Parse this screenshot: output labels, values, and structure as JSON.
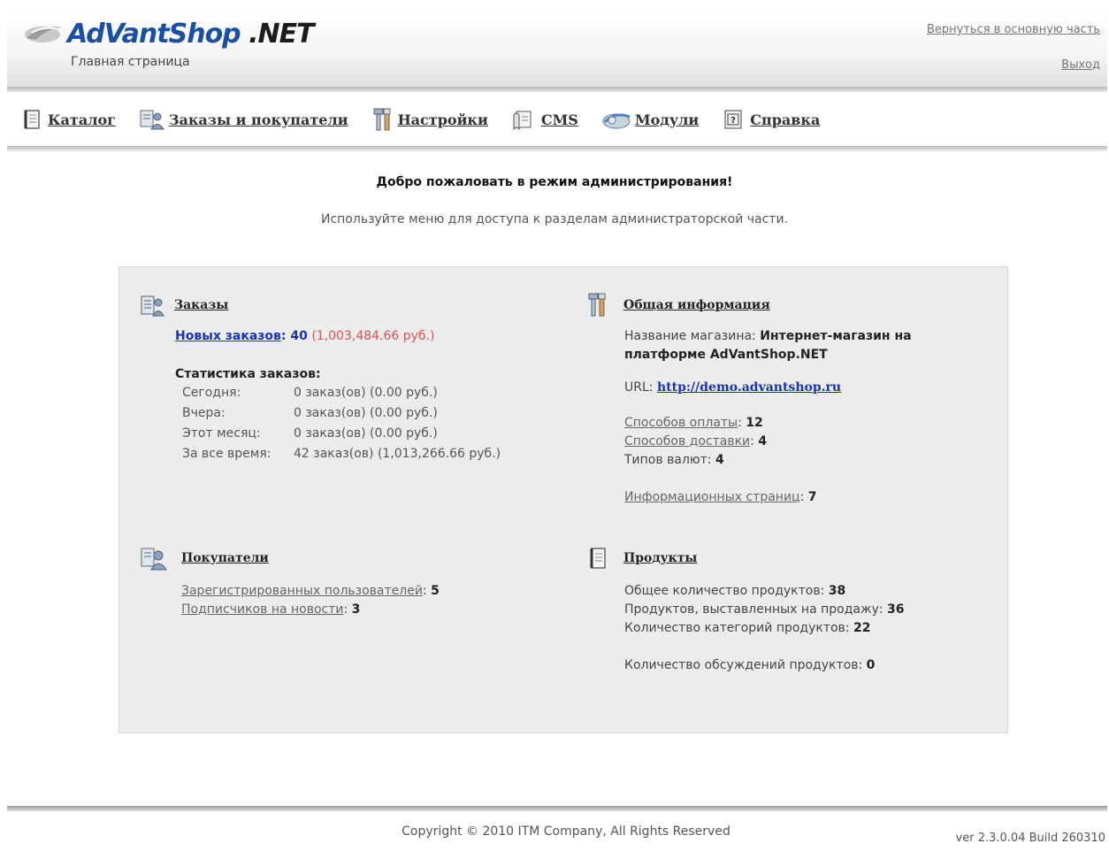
{
  "header": {
    "logo_part1": "AdVantShop",
    "logo_part2": ".NET",
    "page_subtitle": "Главная страница",
    "back_link": "Вернуться в основную часть",
    "logout_link": "Выход"
  },
  "menu": {
    "items": [
      {
        "label": "Каталог",
        "icon": "catalog-icon"
      },
      {
        "label": "Заказы и покупатели",
        "icon": "orders-customers-icon"
      },
      {
        "label": "Настройки",
        "icon": "settings-icon"
      },
      {
        "label": "CMS",
        "icon": "cms-icon"
      },
      {
        "label": "Модули",
        "icon": "modules-icon"
      },
      {
        "label": "Справка",
        "icon": "help-icon"
      }
    ]
  },
  "welcome": {
    "title": "Добро пожаловать в режим администрирования!",
    "hint": "Используйте меню для доступа к разделам администраторской части."
  },
  "orders": {
    "title": "Заказы",
    "new_orders_label": "Новых заказов",
    "new_orders_count": "40",
    "new_orders_sum": "(1,003,484.66 руб.)",
    "stats_title": "Статистика заказов:",
    "stats": [
      {
        "period": "Сегодня:",
        "value": "0 заказ(ов) (0.00 руб.)"
      },
      {
        "period": "Вчера:",
        "value": "0 заказ(ов) (0.00 руб.)"
      },
      {
        "period": "Этот месяц:",
        "value": "0 заказ(ов) (0.00 руб.)"
      },
      {
        "period": "За все время:",
        "value": "42 заказ(ов) (1,013,266.66 руб.)"
      }
    ]
  },
  "general": {
    "title": "Общая информация",
    "store_name_label": "Название магазина:",
    "store_name_value": "Интернет-магазин на платформе AdVantShop.NET",
    "url_label": "URL:",
    "url_value": "http://demo.advantshop.ru",
    "payment_label": "Способов оплаты",
    "payment_value": "12",
    "delivery_label": "Способов доставки",
    "delivery_value": "4",
    "currency_label": "Типов валют:",
    "currency_value": "4",
    "info_pages_label": "Информационных страниц",
    "info_pages_value": "7"
  },
  "customers": {
    "title": "Покупатели",
    "registered_label": "Зарегистрированных пользователей",
    "registered_value": "5",
    "subscribers_label": "Подписчиков на новости",
    "subscribers_value": "3"
  },
  "products": {
    "title": "Продукты",
    "total_label": "Общее количество продуктов:",
    "total_value": "38",
    "on_sale_label": "Продуктов, выставленных на продажу:",
    "on_sale_value": "36",
    "categories_label": "Количество категорий продуктов:",
    "categories_value": "22",
    "reviews_label": "Количество обсуждений продуктов:",
    "reviews_value": "0"
  },
  "footer": {
    "copyright": "Copyright © 2010 ITM Company, All Rights Reserved",
    "version": "ver 2.3.0.04 Build 260310"
  }
}
